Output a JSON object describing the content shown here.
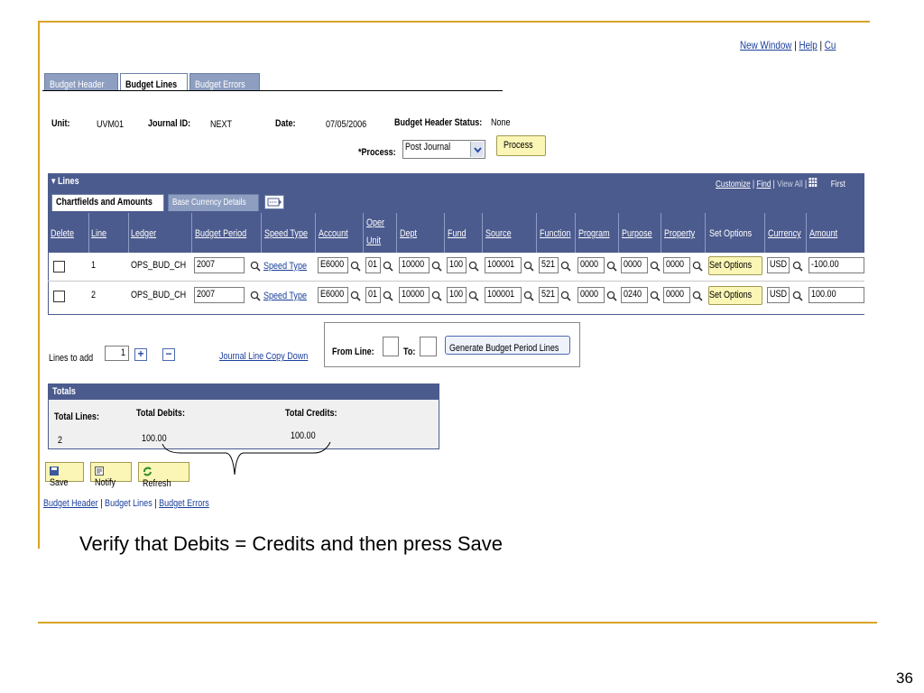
{
  "top_links": {
    "new_window": "New Window",
    "sep1": "|",
    "help": "Help",
    "sep2": "|",
    "cu": "Cu"
  },
  "tabs": [
    {
      "label": "Budget Header"
    },
    {
      "label": "Budget Lines"
    },
    {
      "label": "Budget Errors"
    }
  ],
  "header": {
    "unit_label": "Unit:",
    "unit_value": "UVM01",
    "journal_label": "Journal ID:",
    "journal_value": "NEXT",
    "date_label": "Date:",
    "date_value": "07/05/2006",
    "status_label": "Budget Header Status:",
    "status_value": "None",
    "process_label": "*Process:",
    "process_value": "Post Journal",
    "process_button": "Process"
  },
  "lines_section": {
    "title": "Lines",
    "customize": "Customize",
    "find": "Find",
    "view_all": "View All",
    "first": "First",
    "pipe": "|",
    "subtab_active": "Chartfields and Amounts",
    "subtab_other": "Base Currency Details"
  },
  "grid": {
    "columns": [
      "Delete",
      "Line",
      "Ledger",
      "Budget Period",
      "Speed Type",
      "Account",
      "Oper",
      "Unit",
      "Dept",
      "Fund",
      "Source",
      "Function",
      "Program",
      "Purpose",
      "Property",
      "Set Options",
      "Currency",
      "Amount"
    ],
    "rows": [
      {
        "line": "1",
        "ledger": "OPS_BUD_CH",
        "period": "2007",
        "speed": "Speed Type",
        "account": "E6000",
        "oper": "01",
        "dept": "10000",
        "fund": "100",
        "source": "100001",
        "function": "521",
        "program": "0000",
        "purpose": "0000",
        "property": "0000",
        "set_options": "Set Options",
        "currency": "USD",
        "amount": "-100.00"
      },
      {
        "line": "2",
        "ledger": "OPS_BUD_CH",
        "period": "2007",
        "speed": "Speed Type",
        "account": "E6000",
        "oper": "01",
        "dept": "10000",
        "fund": "100",
        "source": "100001",
        "function": "521",
        "program": "0000",
        "purpose": "0240",
        "property": "0000",
        "set_options": "Set Options",
        "currency": "USD",
        "amount": "100.00"
      }
    ]
  },
  "add_lines": {
    "label": "Lines to add",
    "value": "1",
    "plus": "+",
    "minus": "−",
    "copy_down": "Journal Line Copy Down",
    "from_label": "From Line:",
    "to_label": "To:",
    "generate": "Generate Budget Period Lines"
  },
  "totals": {
    "title": "Totals",
    "lines_label": "Total Lines:",
    "lines_value": "2",
    "debits_label": "Total Debits:",
    "debits_value": "100.00",
    "credits_label": "Total Credits:",
    "credits_value": "100.00"
  },
  "toolbar": {
    "save": "Save",
    "notify": "Notify",
    "refresh": "Refresh"
  },
  "bottom_links": {
    "header": "Budget Header",
    "lines": "Budget Lines",
    "errors": "Budget Errors",
    "sep": "|"
  },
  "caption": "Verify that Debits = Credits and then press Save",
  "slide_number": "36",
  "icons": {
    "search": "magnifier-icon",
    "dropdown": "chevron-down-icon",
    "grid": "grid-view-icon"
  },
  "colors": {
    "accent": "#d9a326",
    "header_bg": "#4c5b8e",
    "button_bg": "#fbf6b5",
    "tab_bg": "#8d9ec0"
  }
}
